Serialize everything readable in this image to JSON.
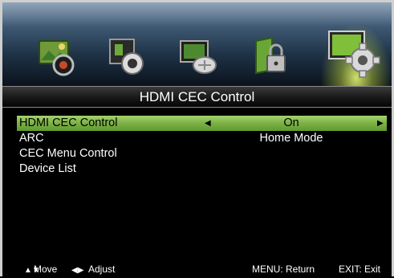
{
  "title": "HDMI CEC Control",
  "tabs": [
    {
      "icon": "picture-icon"
    },
    {
      "icon": "sound-icon"
    },
    {
      "icon": "channel-icon"
    },
    {
      "icon": "lock-icon"
    },
    {
      "icon": "setup-icon"
    }
  ],
  "menu": {
    "items": [
      {
        "label": "HDMI CEC Control",
        "value": "On",
        "selected": true
      },
      {
        "label": "ARC",
        "value": "Home Mode"
      },
      {
        "label": "CEC Menu Control",
        "value": ""
      },
      {
        "label": "Device List",
        "value": ""
      }
    ]
  },
  "footer": {
    "move": "Move",
    "adjust": "Adjust",
    "menu_return": "MENU: Return",
    "exit": "EXIT: Exit"
  },
  "colors": {
    "selection": "#7fb349",
    "band": "#3e5872"
  }
}
